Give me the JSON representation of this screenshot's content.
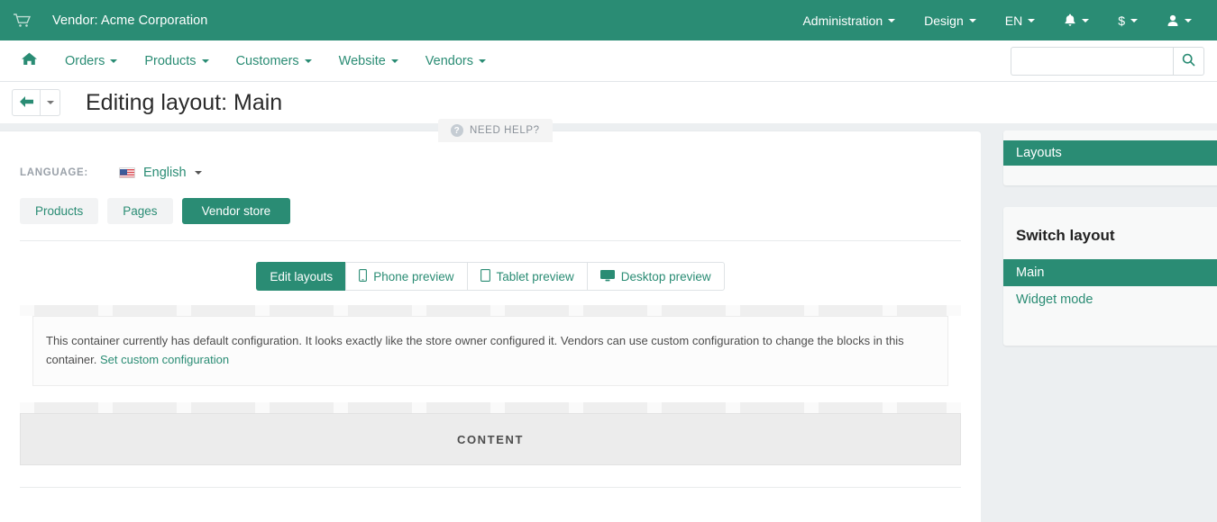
{
  "topbar": {
    "cart_icon": "shopping-cart-icon",
    "vendor_title": "Vendor: Acme Corporation",
    "menus": [
      {
        "label": "Administration",
        "icon": null
      },
      {
        "label": "Design",
        "icon": null
      },
      {
        "label": "EN",
        "icon": null
      },
      {
        "label": "",
        "icon": "bell-icon"
      },
      {
        "label": "$",
        "icon": null
      },
      {
        "label": "",
        "icon": "user-icon"
      }
    ],
    "accent_color": "#2a8c74"
  },
  "navbar": {
    "home_icon": "home-icon",
    "items": [
      {
        "label": "Orders"
      },
      {
        "label": "Products"
      },
      {
        "label": "Customers"
      },
      {
        "label": "Website"
      },
      {
        "label": "Vendors"
      }
    ],
    "search": {
      "value": "",
      "placeholder": "",
      "icon": "search-icon"
    }
  },
  "header": {
    "back_icon": "arrow-left-icon",
    "back_caret_icon": "caret-down-icon",
    "page_title": "Editing layout: Main",
    "need_help": {
      "label": "NEED HELP?",
      "icon": "question-circle-icon"
    }
  },
  "main": {
    "language": {
      "label": "LANGUAGE:",
      "flag_icon": "us-flag-icon",
      "value": "English",
      "caret_icon": "caret-down-icon"
    },
    "scope_buttons": [
      {
        "label": "Products",
        "active": false
      },
      {
        "label": "Pages",
        "active": false
      },
      {
        "label": "Vendor store",
        "active": true
      }
    ],
    "preview_buttons": [
      {
        "label": "Edit layouts",
        "icon": null,
        "active": true
      },
      {
        "label": "Phone preview",
        "icon": "phone-icon",
        "active": false
      },
      {
        "label": "Tablet preview",
        "icon": "tablet-icon",
        "active": false
      },
      {
        "label": "Desktop preview",
        "icon": "desktop-icon",
        "active": false
      }
    ],
    "default_config_notice": {
      "text": "This container currently has default configuration. It looks exactly like the store owner configured it. Vendors can use custom configuration to change the blocks in this container. ",
      "link_label": "Set custom configuration"
    },
    "content_block_label": "CONTENT"
  },
  "sidebar": {
    "layouts_panel": {
      "header": "Layouts"
    },
    "switch_panel": {
      "title": "Switch layout",
      "items": [
        {
          "label": "Main",
          "active": true
        },
        {
          "label": "Widget mode",
          "active": false
        }
      ]
    }
  }
}
